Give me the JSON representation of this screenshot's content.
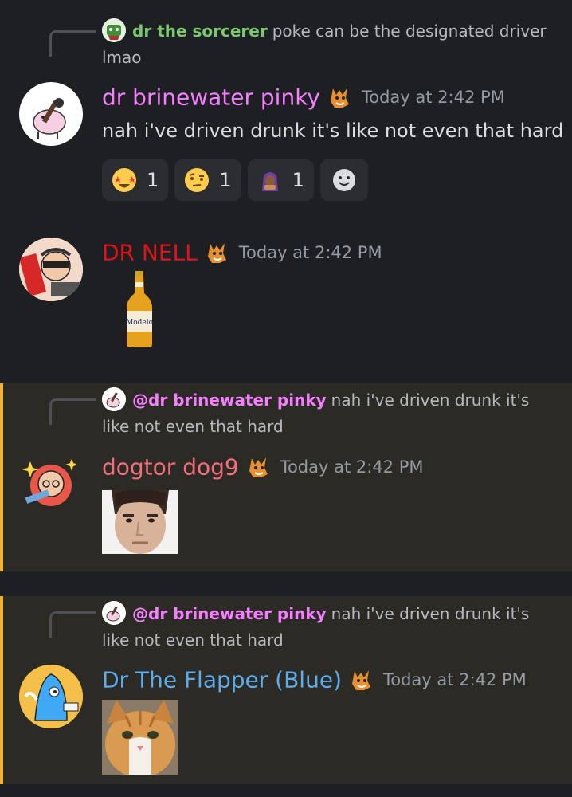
{
  "messages": [
    {
      "reply": {
        "author": "dr the sorcerer",
        "text": "poke can be the designated driver lmao"
      },
      "author": "dr brinewater pinky",
      "timestamp": "Today at 2:42 PM",
      "text": "nah i've driven drunk it's like not even that hard",
      "reactions": [
        {
          "emoji": "star-struck-emoji",
          "count": "1"
        },
        {
          "emoji": "raised-eyebrow-emoji",
          "count": "1"
        },
        {
          "emoji": "hooded-figure-emoji",
          "count": "1"
        }
      ]
    },
    {
      "author": "DR NELL",
      "timestamp": "Today at 2:42 PM",
      "attachment": {
        "type": "beer-bottle-sticker",
        "label": "Modelo"
      }
    },
    {
      "reply": {
        "author": "@dr brinewater pinky",
        "text": "nah i've driven drunk it's like not even that hard"
      },
      "author": "dogtor dog9",
      "timestamp": "Today at 2:42 PM",
      "attachment": {
        "type": "face-photo"
      }
    },
    {
      "reply": {
        "author": "@dr brinewater pinky",
        "text": "nah i've driven drunk it's like not even that hard"
      },
      "author": "Dr The Flapper (Blue)",
      "timestamp": "Today at 2:42 PM",
      "attachment": {
        "type": "cat-photo"
      }
    }
  ],
  "colors": {
    "pinky": "#f47fff",
    "nell": "#e0141a",
    "dog9": "#f26d7d",
    "flapper": "#5dadec",
    "sorcerer": "#7bc96f",
    "highlight_bar": "#f0b232"
  }
}
